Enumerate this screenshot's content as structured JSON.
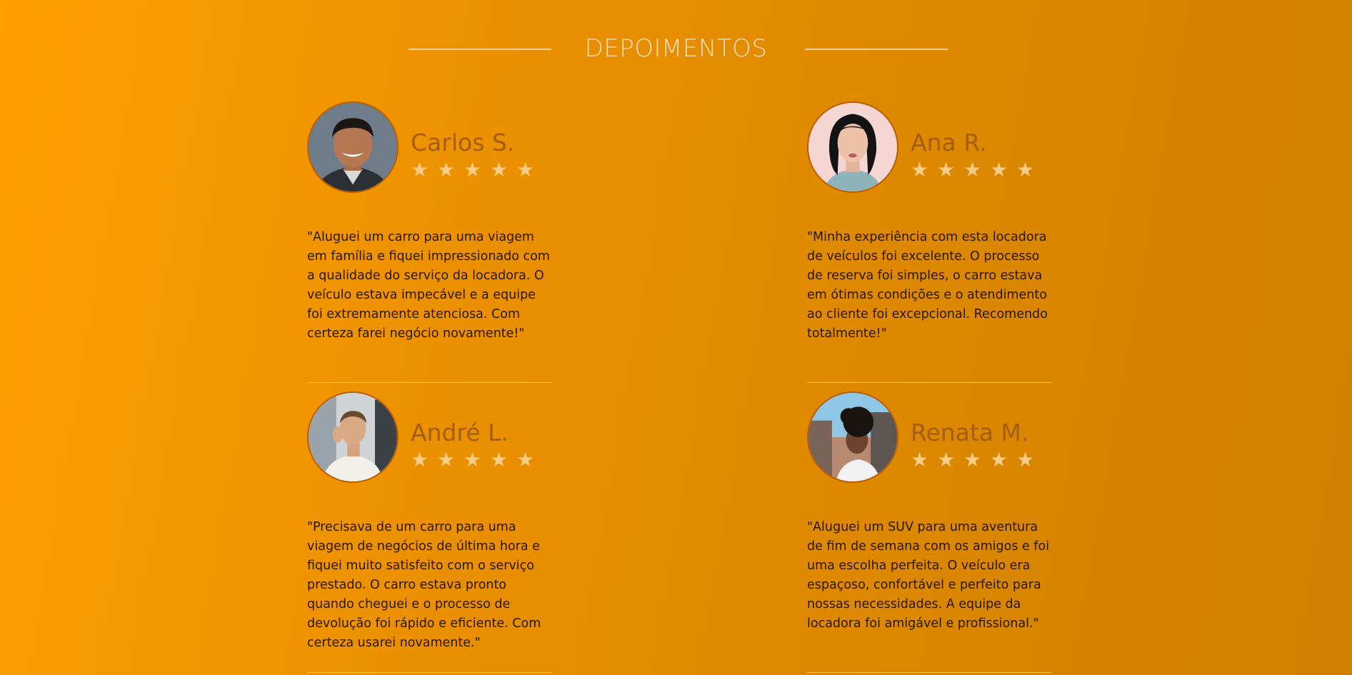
{
  "section": {
    "title": "DEPOIMENTOS"
  },
  "testimonials": [
    {
      "name": "Carlos S.",
      "stars": [
        "★",
        "★",
        "★",
        "★",
        "★"
      ],
      "quote": "\"Aluguei um carro para uma viagem em família e fiquei impressionado com a qualidade do serviço da locadora. O veículo estava impecável e a equipe foi extremamente atenciosa. Com certeza farei negócio novamente!\""
    },
    {
      "name": "Ana R.",
      "stars": [
        "★",
        "★",
        "★",
        "★",
        "★"
      ],
      "quote": "\"Minha experiência com esta locadora de veículos foi excelente. O processo de reserva foi simples, o carro estava em ótimas condições e o atendimento ao cliente foi excepcional. Recomendo totalmente!\""
    },
    {
      "name": "André L.",
      "stars": [
        "★",
        "★",
        "★",
        "★",
        "★"
      ],
      "quote": "\"Precisava de um carro para uma viagem de negócios de última hora e fiquei muito satisfeito com o serviço prestado. O carro estava pronto quando cheguei e o processo de devolução foi rápido e eficiente. Com certeza usarei novamente.\""
    },
    {
      "name": "Renata M.",
      "stars": [
        "★",
        "★",
        "★",
        "★",
        "★"
      ],
      "quote": "\"Aluguei um SUV para uma aventura de fim de semana com os amigos e foi uma escolha perfeita. O veículo era espaçoso, confortável e perfeito para nossas necessidades. A equipe da locadora foi amigável e profissional.\""
    }
  ]
}
